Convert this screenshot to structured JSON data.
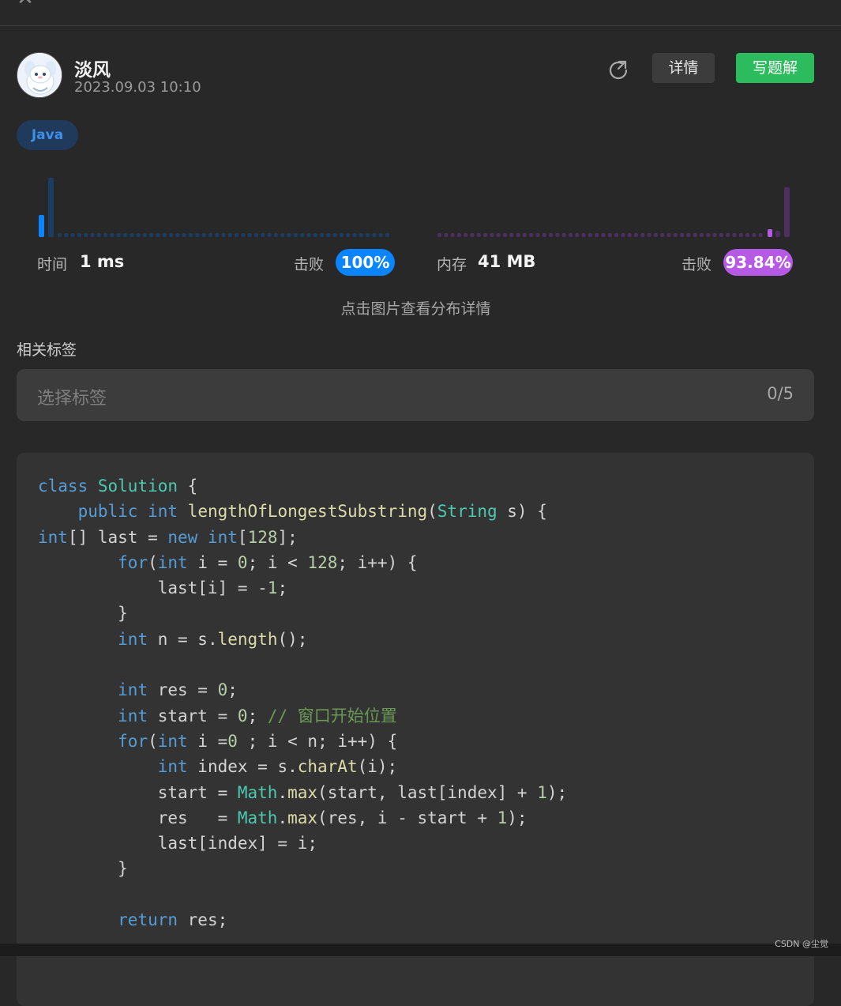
{
  "header": {
    "close_icon": "close-icon"
  },
  "post": {
    "username": "淡风",
    "datetime": "2023.09.03 10:10",
    "language": "Java",
    "share_icon": "share-icon",
    "detail_label": "详情",
    "write_solution_label": "写题解"
  },
  "stats": {
    "time_label": "时间",
    "time_value": "1 ms",
    "time_beat_label": "击败",
    "time_beat": "100%",
    "time_beat_percent": 100,
    "memory_label": "内存",
    "memory_value": "41 MB",
    "memory_beat_label": "击败",
    "memory_beat": "93.84%",
    "memory_beat_percent": 93.84,
    "time_color": "#0a84ff",
    "memory_color": "#b65ae6",
    "hint": "点击图片查看分布详情"
  },
  "tags": {
    "title": "相关标签",
    "placeholder": "选择标签",
    "count": "0/5"
  },
  "code": {
    "language": "Java",
    "lines": [
      [
        [
          "kw",
          "class"
        ],
        [
          "t",
          " "
        ],
        [
          "type",
          "Solution"
        ],
        [
          "t",
          " {"
        ]
      ],
      [
        [
          "t",
          "    "
        ],
        [
          "kw",
          "public"
        ],
        [
          "t",
          " "
        ],
        [
          "kw",
          "int"
        ],
        [
          "t",
          " "
        ],
        [
          "fn",
          "lengthOfLongestSubstring"
        ],
        [
          "t",
          "("
        ],
        [
          "type",
          "String"
        ],
        [
          "t",
          " s) {"
        ]
      ],
      [
        [
          "kw",
          "int"
        ],
        [
          "t",
          "[] last = "
        ],
        [
          "kw",
          "new"
        ],
        [
          "t",
          " "
        ],
        [
          "kw",
          "int"
        ],
        [
          "t",
          "["
        ],
        [
          "num",
          "128"
        ],
        [
          "t",
          "];"
        ]
      ],
      [
        [
          "t",
          "        "
        ],
        [
          "kw",
          "for"
        ],
        [
          "t",
          "("
        ],
        [
          "kw",
          "int"
        ],
        [
          "t",
          " i = "
        ],
        [
          "num",
          "0"
        ],
        [
          "t",
          "; i < "
        ],
        [
          "num",
          "128"
        ],
        [
          "t",
          "; i++) {"
        ]
      ],
      [
        [
          "t",
          "            last[i] = -"
        ],
        [
          "num",
          "1"
        ],
        [
          "t",
          ";"
        ]
      ],
      [
        [
          "t",
          "        }"
        ]
      ],
      [
        [
          "t",
          "        "
        ],
        [
          "kw",
          "int"
        ],
        [
          "t",
          " n = s."
        ],
        [
          "fn",
          "length"
        ],
        [
          "t",
          "();"
        ]
      ],
      [
        [
          "t",
          ""
        ]
      ],
      [
        [
          "t",
          "        "
        ],
        [
          "kw",
          "int"
        ],
        [
          "t",
          " res = "
        ],
        [
          "num",
          "0"
        ],
        [
          "t",
          ";"
        ]
      ],
      [
        [
          "t",
          "        "
        ],
        [
          "kw",
          "int"
        ],
        [
          "t",
          " start = "
        ],
        [
          "num",
          "0"
        ],
        [
          "t",
          "; "
        ],
        [
          "cm",
          "// 窗口开始位置"
        ]
      ],
      [
        [
          "t",
          "        "
        ],
        [
          "kw",
          "for"
        ],
        [
          "t",
          "("
        ],
        [
          "kw",
          "int"
        ],
        [
          "t",
          " i ="
        ],
        [
          "num",
          "0"
        ],
        [
          "t",
          " ; i < n; i++) {"
        ]
      ],
      [
        [
          "t",
          "            "
        ],
        [
          "kw",
          "int"
        ],
        [
          "t",
          " index = s."
        ],
        [
          "fn",
          "charAt"
        ],
        [
          "t",
          "(i);"
        ]
      ],
      [
        [
          "t",
          "            start = "
        ],
        [
          "type",
          "Math"
        ],
        [
          "t",
          "."
        ],
        [
          "fn",
          "max"
        ],
        [
          "t",
          "(start, last[index] + "
        ],
        [
          "num",
          "1"
        ],
        [
          "t",
          ");"
        ]
      ],
      [
        [
          "t",
          "            res   = "
        ],
        [
          "type",
          "Math"
        ],
        [
          "t",
          "."
        ],
        [
          "fn",
          "max"
        ],
        [
          "t",
          "(res, i - start + "
        ],
        [
          "num",
          "1"
        ],
        [
          "t",
          ");"
        ]
      ],
      [
        [
          "t",
          "            last[index] = i;"
        ]
      ],
      [
        [
          "t",
          "        }"
        ]
      ],
      [
        [
          "t",
          ""
        ]
      ],
      [
        [
          "t",
          "        "
        ],
        [
          "kw",
          "return"
        ],
        [
          "t",
          " res;"
        ]
      ]
    ]
  },
  "footer": {
    "watermark": "CSDN @尘觉"
  }
}
